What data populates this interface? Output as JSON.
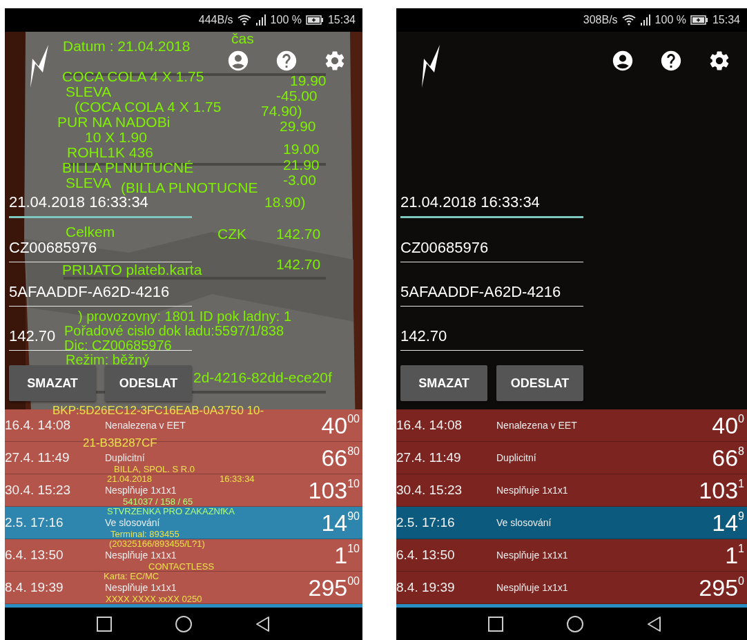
{
  "phones": [
    {
      "kind": "camera",
      "status_bar": {
        "speed": "444B/s",
        "battery": "100 %",
        "time": "15:34"
      },
      "fields": [
        {
          "value": "21.04.2018 16:33:34",
          "focused": true
        },
        {
          "value": "CZ00685976",
          "focused": false
        },
        {
          "value": "5AFAADDF-A62D-4216",
          "focused": false
        },
        {
          "value": "142.70",
          "focused": false
        }
      ],
      "buttons": [
        "SMAZAT",
        "ODESLAT"
      ],
      "ocr_labels": [
        {
          "text": "čas",
          "color": "#7ef000"
        },
        {
          "text": "Datum : 21.04.2018",
          "color": "#7ef000"
        },
        {
          "text": "19.90",
          "color": "#7ef000"
        },
        {
          "text": "COCA COLA 4 X 1.75",
          "color": "#7ef000"
        },
        {
          "text": "-45.00",
          "color": "#7ef000"
        },
        {
          "text": "SLEVA",
          "color": "#7ef000"
        },
        {
          "text": "74.90)",
          "color": "#7ef000"
        },
        {
          "text": "(COCA COLA 4 X 1.75",
          "color": "#7ef000"
        },
        {
          "text": "29.90",
          "color": "#7ef000"
        },
        {
          "text": "PUR NA NADOBi",
          "color": "#7ef000"
        },
        {
          "text": "10 X 1.90",
          "color": "#7ef000"
        },
        {
          "text": "19.00",
          "color": "#7ef000"
        },
        {
          "text": "ROHL1K 436",
          "color": "#7ef000"
        },
        {
          "text": "21.90",
          "color": "#7ef000"
        },
        {
          "text": "BILLA PLNUTUCNÉ",
          "color": "#7ef000"
        },
        {
          "text": "SLEVA",
          "color": "#7ef000"
        },
        {
          "text": "-3.00",
          "color": "#7ef000"
        },
        {
          "text": "(BILLA PLNOTUCNE",
          "color": "#7ef000"
        },
        {
          "text": "18.90)",
          "color": "#7ef000"
        },
        {
          "text": "Celkem",
          "color": "#7ef000"
        },
        {
          "text": "CZK",
          "color": "#7ef000"
        },
        {
          "text": "142.70",
          "color": "#7ef000"
        },
        {
          "text": "PRIJATO plateb.karta",
          "color": "#7ef000"
        },
        {
          "text": "142.70",
          "color": "#7ef000"
        },
        {
          "text": ") provozovny: 1801 ID pok ladny: 1",
          "color": "#7ef000"
        },
        {
          "text": "Pořadové cislo dok ladu:5597/1/838",
          "color": "#7ef000"
        },
        {
          "text": "Dic: CZ00685976",
          "color": "#7ef000"
        },
        {
          "text": "Režim: běžný",
          "color": "#7ef000"
        },
        {
          "text": "2d-4216-82dd-ece20f",
          "color": "#7ef000"
        },
        {
          "text": "BKP:5D26EC12-3FC16EAB-0A3750 10-",
          "color": "#ece24a"
        },
        {
          "text": "21-B3B287CF",
          "color": "#ece24a"
        },
        {
          "text": "BILLA, SPOL. S R.0",
          "color": "#ece24a"
        },
        {
          "text": "21.04.2018",
          "color": "#ece24a"
        },
        {
          "text": "16:33:34",
          "color": "#ece24a"
        },
        {
          "text": "541037 / 158 / 65",
          "color": "#b0ff78"
        },
        {
          "text": "STVRZENKA PRO ZAKAZNfKA",
          "color": "#b0ff78"
        },
        {
          "text": "Terminal: 893455",
          "color": "#ece24a"
        },
        {
          "text": "(20325166/893455/L?1)",
          "color": "#ece24a"
        },
        {
          "text": "CONTACTLESS",
          "color": "#ece24a"
        },
        {
          "text": "Karta: EC/MC",
          "color": "#ece24a"
        },
        {
          "text": "XXXX XXXX xxXX 0250",
          "color": "#ece24a"
        }
      ],
      "receipts": [
        {
          "time": "16.4. 14:08",
          "status": "Nenalezena v EET",
          "amount": "40",
          "cents": "00",
          "color": "#b4554c"
        },
        {
          "time": "27.4. 11:49",
          "status": "Duplicitní",
          "amount": "66",
          "cents": "80",
          "color": "#b4554c"
        },
        {
          "time": "30.4. 15:23",
          "status": "Nesplňuje 1x1x1",
          "amount": "103",
          "cents": "10",
          "color": "#b4554c"
        },
        {
          "time": "2.5. 17:16",
          "status": "Ve slosování",
          "amount": "14",
          "cents": "90",
          "color": "#2e86ae"
        },
        {
          "time": "6.4. 13:50",
          "status": "Nesplňuje 1x1x1",
          "amount": "1",
          "cents": "10",
          "color": "#b4554c"
        },
        {
          "time": "8.4. 19:39",
          "status": "Nesplňuje 1x1x1",
          "amount": "295",
          "cents": "00",
          "color": "#b4554c"
        }
      ]
    },
    {
      "kind": "dark",
      "status_bar": {
        "speed": "308B/s",
        "battery": "100 %",
        "time": "15:34"
      },
      "fields": [
        {
          "value": "21.04.2018 16:33:34",
          "focused": true
        },
        {
          "value": "CZ00685976",
          "focused": false
        },
        {
          "value": "5AFAADDF-A62D-4216",
          "focused": false
        },
        {
          "value": "142.70",
          "focused": false
        }
      ],
      "buttons": [
        "SMAZAT",
        "ODESLAT"
      ],
      "receipts": [
        {
          "time": "16.4. 14:08",
          "status": "Nenalezena v EET",
          "amount": "40",
          "cents": "0",
          "color": "#7b2420"
        },
        {
          "time": "27.4. 11:49",
          "status": "Duplicitní",
          "amount": "66",
          "cents": "8",
          "color": "#7b2420"
        },
        {
          "time": "30.4. 15:23",
          "status": "Nesplňuje 1x1x1",
          "amount": "103",
          "cents": "1",
          "color": "#7b2420"
        },
        {
          "time": "2.5. 17:16",
          "status": "Ve slosování",
          "amount": "14",
          "cents": "9",
          "color": "#0c5a7e"
        },
        {
          "time": "6.4. 13:50",
          "status": "Nesplňuje 1x1x1",
          "amount": "1",
          "cents": "1",
          "color": "#7b2420"
        },
        {
          "time": "8.4. 19:39",
          "status": "Nesplňuje 1x1x1",
          "amount": "295",
          "cents": "0",
          "color": "#7b2420"
        }
      ]
    }
  ]
}
